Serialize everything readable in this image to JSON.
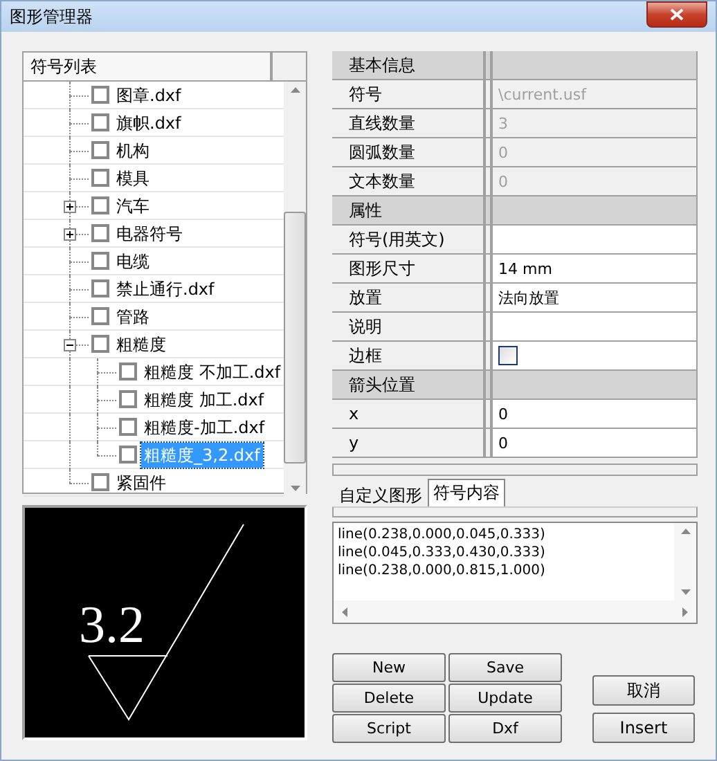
{
  "window": {
    "title": "图形管理器"
  },
  "tree": {
    "header": "符号列表",
    "items": [
      {
        "label": "图章.dxf",
        "checked": false,
        "selected": false
      },
      {
        "label": "旗帜.dxf",
        "checked": false,
        "selected": false
      },
      {
        "label": "机构",
        "checked": false,
        "selected": false
      },
      {
        "label": "模具",
        "checked": false,
        "selected": false
      },
      {
        "label": "汽车",
        "checked": false,
        "selected": false,
        "expanded": false
      },
      {
        "label": "电器符号",
        "checked": false,
        "selected": false,
        "expanded": false
      },
      {
        "label": "电缆",
        "checked": false,
        "selected": false
      },
      {
        "label": "禁止通行.dxf",
        "checked": false,
        "selected": false
      },
      {
        "label": "管路",
        "checked": false,
        "selected": false
      },
      {
        "label": "粗糙度",
        "checked": false,
        "selected": false,
        "expanded": true,
        "children": [
          {
            "label": "粗糙度 不加工.dxf",
            "checked": false,
            "selected": false
          },
          {
            "label": "粗糙度 加工.dxf",
            "checked": false,
            "selected": false
          },
          {
            "label": "粗糙度-加工.dxf",
            "checked": false,
            "selected": false
          },
          {
            "label": "粗糙度_3,2.dxf",
            "checked": false,
            "selected": true
          }
        ]
      },
      {
        "label": "紧固件",
        "checked": false,
        "selected": false
      }
    ]
  },
  "preview": {
    "label": "3.2"
  },
  "properties": [
    {
      "kind": "section",
      "label": "基本信息"
    },
    {
      "kind": "field",
      "label": "符号",
      "value": "\\current.usf",
      "disabled": true
    },
    {
      "kind": "field",
      "label": "直线数量",
      "value": "3",
      "disabled": true
    },
    {
      "kind": "field",
      "label": "圆弧数量",
      "value": "0",
      "disabled": true
    },
    {
      "kind": "field",
      "label": "文本数量",
      "value": "0",
      "disabled": true
    },
    {
      "kind": "section",
      "label": "属性"
    },
    {
      "kind": "field",
      "label": "符号(用英文)",
      "disabled": false
    },
    {
      "kind": "field",
      "label": "图形尺寸",
      "value": "14 mm",
      "disabled": false
    },
    {
      "kind": "field",
      "label": "放置",
      "value": "法向放置",
      "disabled": false
    },
    {
      "kind": "field",
      "label": "说明",
      "disabled": false
    },
    {
      "kind": "checkbox",
      "label": "边框",
      "checked": false
    },
    {
      "kind": "section",
      "label": "箭头位置"
    },
    {
      "kind": "field",
      "label": "x",
      "value": "0",
      "disabled": false
    },
    {
      "kind": "field",
      "label": "y",
      "value": "0",
      "disabled": false
    }
  ],
  "tabs": [
    {
      "label": "自定义图形",
      "selected": false
    },
    {
      "label": "符号内容",
      "selected": true
    }
  ],
  "content": [
    "line(0.238,0.000,0.045,0.333)",
    "line(0.045,0.333,0.430,0.333)",
    "line(0.238,0.000,0.815,1.000)"
  ],
  "buttons": [
    "New",
    "Save",
    "Delete",
    "Update",
    "Script",
    "Dxf"
  ],
  "side_buttons": [
    "取消",
    "Insert"
  ]
}
